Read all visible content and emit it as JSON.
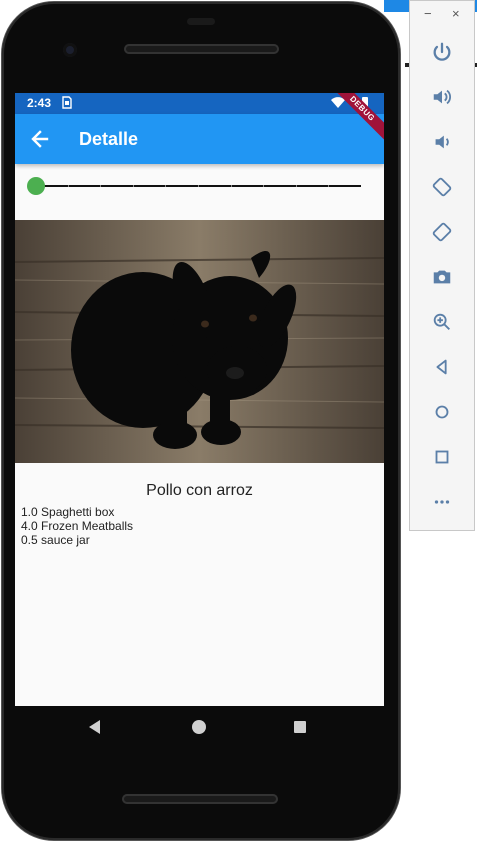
{
  "status_bar": {
    "time": "2:43",
    "sim_icon": "sim-card-icon",
    "wifi_icon": "wifi-icon",
    "battery_icon": "battery-icon"
  },
  "app_bar": {
    "title": "Detalle",
    "back_icon": "arrow-back-icon"
  },
  "debug_banner": "DEBUG",
  "slider": {
    "value": 0,
    "min": 0,
    "max": 10,
    "divisions": 10,
    "active_color": "#4caf50"
  },
  "photo": {
    "subject": "black puppy on wooden floor"
  },
  "recipe": {
    "title": "Pollo con arroz",
    "ingredients": [
      "1.0 Spaghetti box",
      "4.0 Frozen Meatballs",
      "0.5 sauce jar"
    ]
  },
  "nav": {
    "back_icon": "nav-back-icon",
    "home_icon": "nav-home-icon",
    "recents_icon": "nav-recents-icon"
  },
  "emulator_panel": {
    "minimize": "−",
    "close": "×",
    "tools": [
      "power-icon",
      "volume-up-icon",
      "volume-down-icon",
      "rotate-left-icon",
      "rotate-right-icon",
      "camera-icon",
      "zoom-icon",
      "back-icon",
      "home-icon",
      "overview-icon",
      "more-icon"
    ],
    "tool_color": "#5b7fa8"
  }
}
